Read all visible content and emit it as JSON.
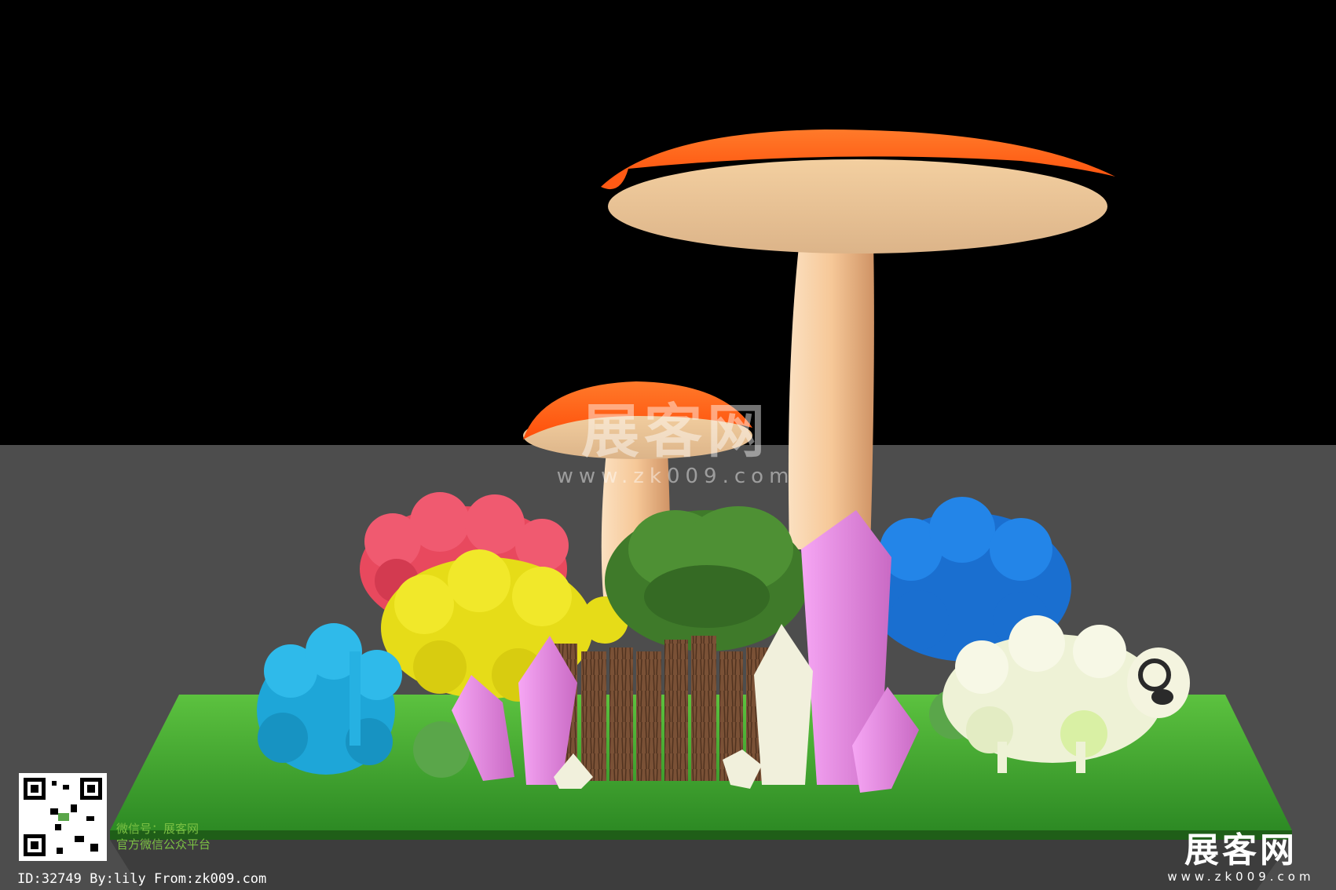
{
  "scene": {
    "colors": {
      "sky": "#000000",
      "floor": "#4d4d4d",
      "grass": "#3d9a2b",
      "mushroom_cap": "#ff5a14",
      "mushroom_stem": "#f5c08c",
      "red_sheep": "#e8495e",
      "yellow_sheep": "#e6dc18",
      "blue_sheep": "#1a6fd0",
      "cyan_sheep": "#1ea6d8",
      "white_sheep": "#eef2d6",
      "crystal_pink": "#e480e0",
      "crystal_white": "#f1f0dc",
      "log": "#7a5136"
    },
    "watermark_center": {
      "cn": "展客网",
      "url": "www.zk009.com"
    },
    "watermark_corner": {
      "cn": "展客网",
      "url": "www.zk009.com"
    },
    "qr_caption": {
      "line1": "微信号：展客网",
      "line2": "官方微信公众平台"
    },
    "footer_id": "ID:32749 By:lily From:zk009.com"
  }
}
